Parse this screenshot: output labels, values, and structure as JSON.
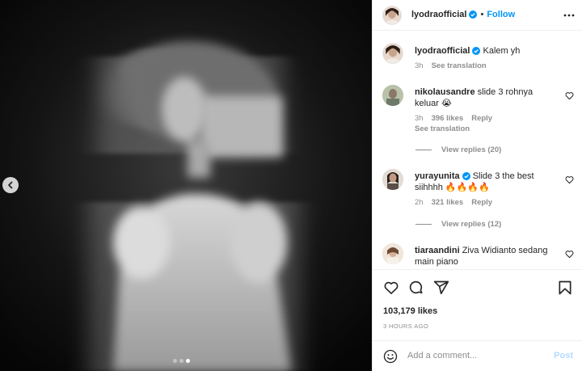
{
  "post": {
    "author": "lyodraofficial",
    "follow_label": "Follow",
    "dot": "•",
    "caption": "Kalem yh",
    "caption_time": "3h",
    "caption_see_translation": "See translation",
    "likes": "103,179 likes",
    "posted": "3 HOURS AGO",
    "carousel_dots": 3,
    "carousel_active": 2
  },
  "comments": [
    {
      "user": "nikolausandre",
      "text": "slide 3 rohnya keluar 😭",
      "time": "3h",
      "likes": "396 likes",
      "reply": "Reply",
      "see_translation": "See translation",
      "view_replies": "View replies (20)"
    },
    {
      "user": "yurayunita",
      "text": "Slide 3 the best siihhhh 🔥🔥🔥🔥",
      "time": "2h",
      "likes": "321 likes",
      "reply": "Reply",
      "view_replies": "View replies (12)"
    },
    {
      "user": "tiaraandini",
      "text": "Ziva Widianto sedang main piano"
    }
  ],
  "add_comment": {
    "placeholder": "Add a comment...",
    "post_label": "Post"
  },
  "icons": [
    "verified-icon",
    "more-icon",
    "heart-icon",
    "comment-icon",
    "share-icon",
    "bookmark-icon",
    "emoji-icon",
    "chevron-left-icon"
  ],
  "colors": {
    "accent": "#0095f6",
    "muted": "#8e8e8e",
    "text": "#262626",
    "border": "#efefef",
    "post_disabled": "#b3dbff"
  }
}
